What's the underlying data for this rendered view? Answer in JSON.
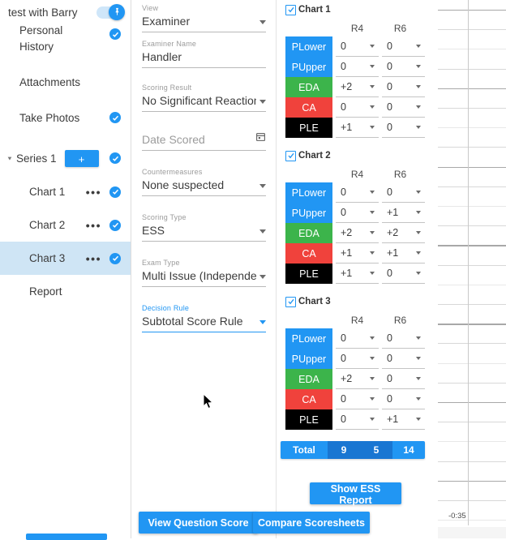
{
  "sidebar": {
    "header": {
      "title": "test with Barry",
      "toggle_icon": "pin-icon",
      "toggle_on": true
    },
    "items": [
      {
        "label": "Personal\nHistory",
        "checked": true
      },
      {
        "label": "Attachments",
        "checked": false
      },
      {
        "label": "Take Photos",
        "checked": true
      }
    ],
    "series": {
      "label": "Series 1",
      "add_label": "+",
      "checked": true,
      "expanded": true
    },
    "charts": [
      {
        "label": "Chart 1",
        "menu": "•••",
        "checked": true,
        "selected": false
      },
      {
        "label": "Chart 2",
        "menu": "•••",
        "checked": true,
        "selected": false
      },
      {
        "label": "Chart 3",
        "menu": "•••",
        "checked": true,
        "selected": true
      }
    ],
    "report": {
      "label": "Report"
    }
  },
  "form": {
    "fields": [
      {
        "label": "View",
        "value": "Examiner",
        "type": "select",
        "placeholder": "",
        "accent": false
      },
      {
        "label": "Examiner Name",
        "value": "Handler",
        "type": "text",
        "placeholder": "",
        "accent": false
      },
      {
        "label": "Scoring Result",
        "value": "No Significant Reactions",
        "type": "select",
        "placeholder": "",
        "accent": false
      },
      {
        "label": "",
        "value": "",
        "type": "date",
        "placeholder": "Date Scored",
        "accent": false
      },
      {
        "label": "Countermeasures",
        "value": "None suspected",
        "type": "select",
        "placeholder": "",
        "accent": false
      },
      {
        "label": "Scoring Type",
        "value": "ESS",
        "type": "select",
        "placeholder": "",
        "accent": false
      },
      {
        "label": "Exam Type",
        "value": "Multi Issue (Independent)",
        "type": "select",
        "placeholder": "",
        "accent": false
      },
      {
        "label": "Decision Rule",
        "value": "Subtotal Score Rule",
        "type": "select",
        "placeholder": "",
        "accent": true
      }
    ]
  },
  "score": {
    "columns": [
      "R4",
      "R6"
    ],
    "row_labels": [
      "PLower",
      "PUpper",
      "EDA",
      "CA",
      "PLE"
    ],
    "row_colors": [
      "#2196f3",
      "#2196f3",
      "#3cb44b",
      "#f0423c",
      "#000000"
    ],
    "charts": [
      {
        "title": "Chart 1",
        "checked": true,
        "rows": [
          {
            "label": "PLower",
            "R4": "0",
            "R6": "0"
          },
          {
            "label": "PUpper",
            "R4": "0",
            "R6": "0"
          },
          {
            "label": "EDA",
            "R4": "+2",
            "R6": "0"
          },
          {
            "label": "CA",
            "R4": "0",
            "R6": "0"
          },
          {
            "label": "PLE",
            "R4": "+1",
            "R6": "0"
          }
        ]
      },
      {
        "title": "Chart 2",
        "checked": true,
        "rows": [
          {
            "label": "PLower",
            "R4": "0",
            "R6": "0"
          },
          {
            "label": "PUpper",
            "R4": "0",
            "R6": "+1"
          },
          {
            "label": "EDA",
            "R4": "+2",
            "R6": "+2"
          },
          {
            "label": "CA",
            "R4": "+1",
            "R6": "+1"
          },
          {
            "label": "PLE",
            "R4": "+1",
            "R6": "0"
          }
        ]
      },
      {
        "title": "Chart 3",
        "checked": true,
        "rows": [
          {
            "label": "PLower",
            "R4": "0",
            "R6": "0"
          },
          {
            "label": "PUpper",
            "R4": "0",
            "R6": "0"
          },
          {
            "label": "EDA",
            "R4": "+2",
            "R6": "0"
          },
          {
            "label": "CA",
            "R4": "0",
            "R6": "0"
          },
          {
            "label": "PLE",
            "R4": "0",
            "R6": "+1"
          }
        ]
      }
    ],
    "total": {
      "label": "Total",
      "a": "9",
      "b": "5",
      "c": "14"
    },
    "buttons": {
      "ess_report": "Show ESS Report",
      "view_question_score": "View Question Score",
      "compare_scoresheets": "Compare Scoresheets"
    }
  },
  "graph": {
    "axis_label": "-0:35"
  },
  "colors": {
    "accent": "#2196f3",
    "accent_dark": "#1976d2",
    "green": "#3cb44b",
    "red": "#f0423c",
    "black": "#000000",
    "selected_row": "#cfe5f5"
  }
}
